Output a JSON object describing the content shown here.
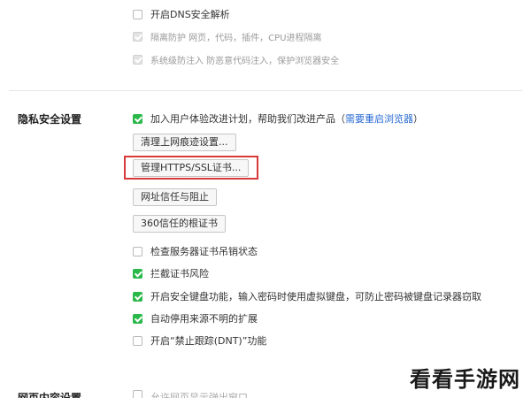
{
  "top_options": [
    {
      "label": "开启DNS安全解析",
      "checked": false,
      "disabled": false
    },
    {
      "label": "隔离防护  网页，代码，插件，CPU进程隔离",
      "checked": true,
      "disabled": true
    },
    {
      "label": "系统级防注入  防恶意代码注入，保护浏览器安全",
      "checked": true,
      "disabled": true
    }
  ],
  "privacy": {
    "title": "隐私安全设置",
    "join_program": {
      "label": "加入用户体验改进计划，帮助我们改进产品（",
      "link": "需要重启浏览器",
      "suffix": "）",
      "checked": true
    },
    "buttons": {
      "clear_traces": "清理上网痕迹设置...",
      "manage_https": "管理HTTPS/SSL证书...",
      "trusted_sites": "网址信任与阻止",
      "root_certs": "360信任的根证书"
    },
    "options": [
      {
        "label": "检查服务器证书吊销状态",
        "checked": false
      },
      {
        "label": "拦截证书风险",
        "checked": true
      },
      {
        "label": "开启安全键盘功能，输入密码时使用虚拟键盘，可防止密码被键盘记录器窃取",
        "checked": true
      },
      {
        "label": "自动停用来源不明的扩展",
        "checked": true
      },
      {
        "label": "开启“禁止跟踪(DNT)”功能",
        "checked": false
      }
    ]
  },
  "next_section": {
    "title": "网页内容设置",
    "first_option": "允许网页显示弹出窗口"
  },
  "watermark": "看看手游网",
  "colors": {
    "checkbox_checked": "#2bb84a",
    "link": "#2a6bd4",
    "highlight": "#d63a3a"
  }
}
